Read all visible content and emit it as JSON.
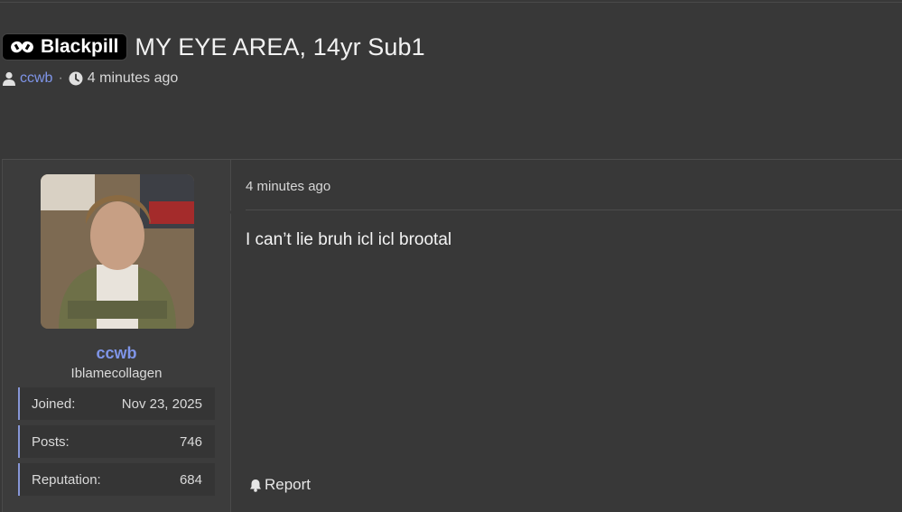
{
  "thread": {
    "prefix_label": "Blackpill",
    "title": "MY EYE AREA, 14yr Sub1",
    "author": "ccwb",
    "separator": "·",
    "posted_ago": "4 minutes ago"
  },
  "post": {
    "date": "4 minutes ago",
    "content": "I can’t lie bruh icl icl brootal",
    "report_label": "Report"
  },
  "user": {
    "name": "ccwb",
    "title": "Iblamecollagen",
    "stats": [
      {
        "label": "Joined:",
        "value": "Nov 23, 2025"
      },
      {
        "label": "Posts:",
        "value": "746"
      },
      {
        "label": "Reputation:",
        "value": "684"
      }
    ]
  },
  "colors": {
    "background": "#383838",
    "accent_link": "#7f95e8",
    "stat_border": "#8796d6",
    "prefix_bg": "#000000"
  },
  "icons": [
    "pill-icon",
    "user-icon",
    "clock-icon",
    "bell-icon"
  ]
}
